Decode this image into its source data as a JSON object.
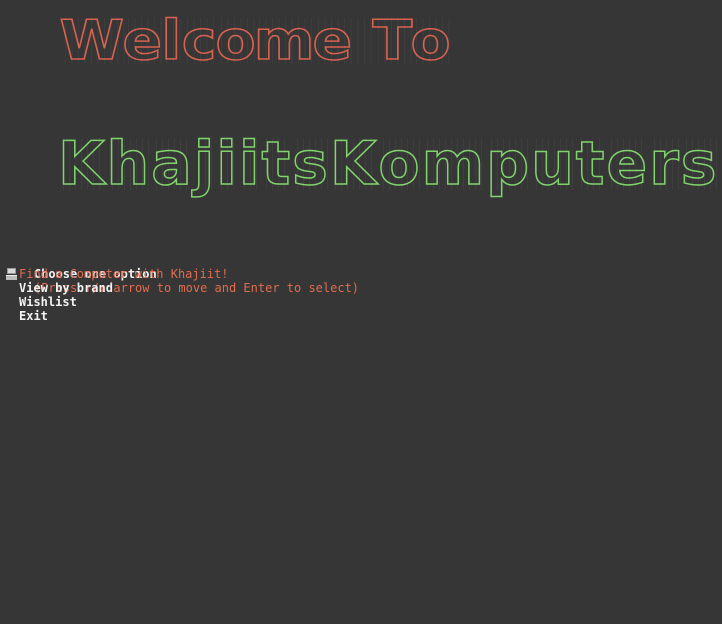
{
  "banner": {
    "welcome_text": "Welcome To",
    "title_text": "KhajiitsKomputers",
    "colors": {
      "welcome": "#d8614f",
      "title": "#7fd36b"
    }
  },
  "prompt": {
    "question": "Choose one option",
    "hint": "(Press ↑/↓ arrow to move and Enter to select)"
  },
  "menu": {
    "cursor_icon": "computer-icon",
    "items": [
      {
        "label": "Find a Computer with Khajiit!",
        "selected": true
      },
      {
        "label": "View by brand",
        "selected": false
      },
      {
        "label": "Wishlist",
        "selected": false
      },
      {
        "label": "Exit",
        "selected": false
      }
    ]
  },
  "colors": {
    "background": "#363636",
    "text": "#f2f2f2",
    "accent": "#e06c4f"
  }
}
